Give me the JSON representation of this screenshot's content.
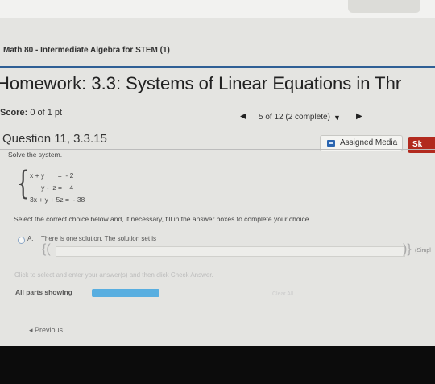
{
  "course": {
    "title": "Math 80 - Intermediate Algebra for STEM (1)"
  },
  "homework": {
    "title": "Homework: 3.3: Systems of Linear Equations in Thr"
  },
  "score": {
    "label": "Score:",
    "value": "0 of 1 pt"
  },
  "nav": {
    "prev_icon": "◀",
    "counter": "5 of 12 (2 complete)",
    "dropdown_icon": "▼",
    "next_icon": "▶"
  },
  "question": {
    "title": "Question 11, 3.3.15",
    "instruction": "Solve the system."
  },
  "buttons": {
    "assigned_media": "Assigned Media",
    "red_button": "Sk"
  },
  "system": {
    "brace": "{",
    "eq1": "x + y       =  - 2",
    "eq2": "      y -  z =    4",
    "eq3": "3x + y + 5z =  - 38"
  },
  "prompt": {
    "select_text": "Select the correct choice below and, if necessary, fill in the answer boxes to complete your choice."
  },
  "choice_a": {
    "letter": "A.",
    "text": "There is one solution. The solution set is",
    "open": "{(",
    "close": ")}",
    "note": "(Simpl"
  },
  "footer": {
    "click_text": "Click to select and enter your answer(s) and then click Check Answer.",
    "parts_label": "All parts showing",
    "progress_fraction": 1.0,
    "clear_all": "Clear All",
    "previous": "◂ Previous"
  },
  "colors": {
    "accent_blue": "#2f5f95",
    "progress": "#58aee0",
    "red_button": "#b22a1e"
  }
}
